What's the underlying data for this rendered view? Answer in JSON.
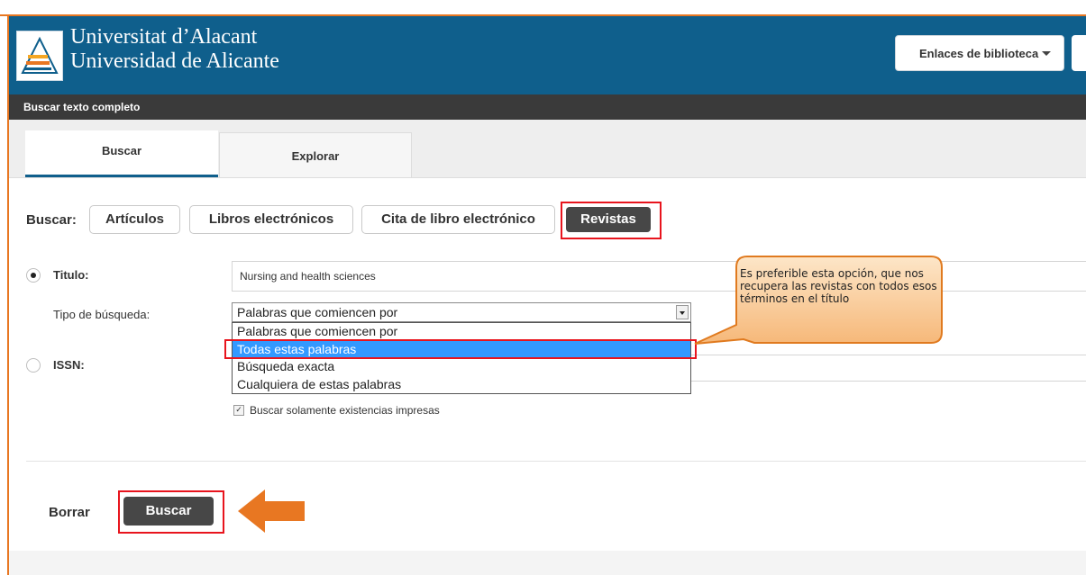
{
  "header": {
    "university_line1": "Universitat d’Alacant",
    "university_line2": "Universidad de Alicante",
    "library_links_label": "Enlaces de biblioteca"
  },
  "title_bar": "Buscar texto completo",
  "tabs": [
    {
      "label": "Buscar",
      "active": true
    },
    {
      "label": "Explorar",
      "active": false
    }
  ],
  "search_type": {
    "label": "Buscar:",
    "options": [
      "Artículos",
      "Libros electrónicos",
      "Cita de libro electrónico",
      "Revistas"
    ],
    "selected": "Revistas"
  },
  "form": {
    "title_label": "Titulo:",
    "title_value": "Nursing and health sciences",
    "title_radio_selected": true,
    "search_kind_label": "Tipo de búsqueda:",
    "search_kind_value": "Palabras que comiencen por",
    "search_kind_options": [
      "Palabras que comiencen por",
      "Todas estas palabras",
      "Búsqueda exacta",
      "Cualquiera de estas palabras"
    ],
    "search_kind_highlighted": "Todas estas palabras",
    "issn_label": "ISSN:",
    "issn_value": "",
    "print_only_label": "Buscar solamente existencias impresas",
    "print_only_checked": true
  },
  "actions": {
    "clear_label": "Borrar",
    "search_label": "Buscar"
  },
  "annotation": {
    "callout_text": "Es preferible esta opción, que nos recupera las revistas con todos esos términos en el título"
  },
  "colors": {
    "header_blue": "#0f5f8c",
    "dark_button": "#474747",
    "highlight_red": "#e8141d",
    "annotation_orange": "#e87722",
    "selected_option_blue": "#3399ff"
  }
}
